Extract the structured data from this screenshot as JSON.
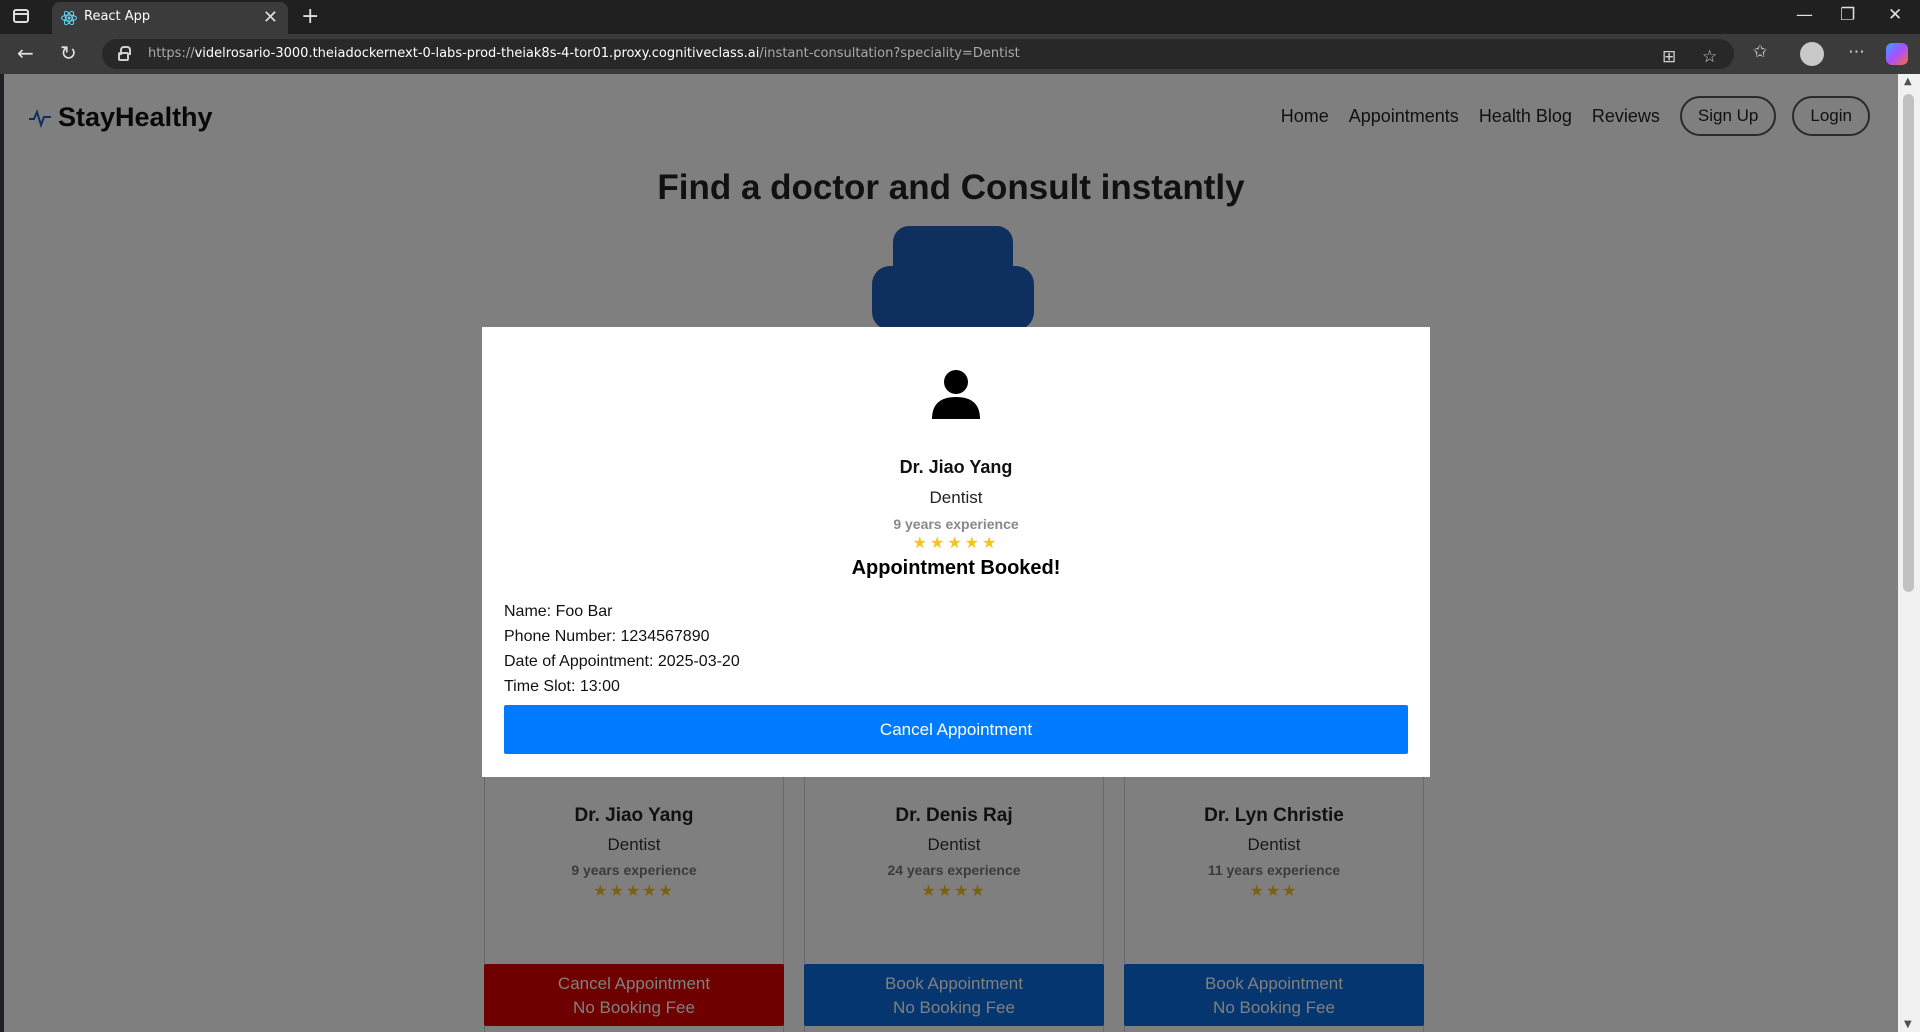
{
  "browser": {
    "tab_title": "React App",
    "url_scheme": "https://",
    "url_host": "videlrosario-3000.theiadockernext-0-labs-prod-theiak8s-4-tor01.proxy.cognitiveclass.ai",
    "url_path": "/instant-consultation?speciality=Dentist"
  },
  "navbar": {
    "logo": "StayHealthy",
    "links": [
      "Home",
      "Appointments",
      "Health Blog",
      "Reviews"
    ],
    "signup": "Sign Up",
    "login": "Login"
  },
  "page": {
    "title": "Find a doctor and Consult instantly"
  },
  "doctors": [
    {
      "name": "Dr. Jiao Yang",
      "speciality": "Dentist",
      "experience": "9 years experience",
      "stars": "★★★★★",
      "button_line1": "Cancel Appointment",
      "button_line2": "No Booking Fee",
      "button_color": "#dc0000"
    },
    {
      "name": "Dr. Denis Raj",
      "speciality": "Dentist",
      "experience": "24 years experience",
      "stars": "★★★★",
      "button_line1": "Book Appointment",
      "button_line2": "No Booking Fee",
      "button_color": "#0a6ce0"
    },
    {
      "name": "Dr. Lyn Christie",
      "speciality": "Dentist",
      "experience": "11 years experience",
      "stars": "★★★",
      "button_line1": "Book Appointment",
      "button_line2": "No Booking Fee",
      "button_color": "#0a6ce0"
    }
  ],
  "modal": {
    "name": "Dr. Jiao Yang",
    "speciality": "Dentist",
    "experience": "9 years experience",
    "stars": "★★★★★",
    "status": "Appointment Booked!",
    "patient_name": "Name: Foo Bar",
    "phone": "Phone Number: 1234567890",
    "date": "Date of Appointment: 2025-03-20",
    "time_slot": "Time Slot: 13:00",
    "cancel_button": "Cancel Appointment"
  },
  "colors": {
    "primary": "#007bff",
    "cancel_red": "#dc0000",
    "star": "#f5c518",
    "search_icon": "#1f5fbf"
  }
}
